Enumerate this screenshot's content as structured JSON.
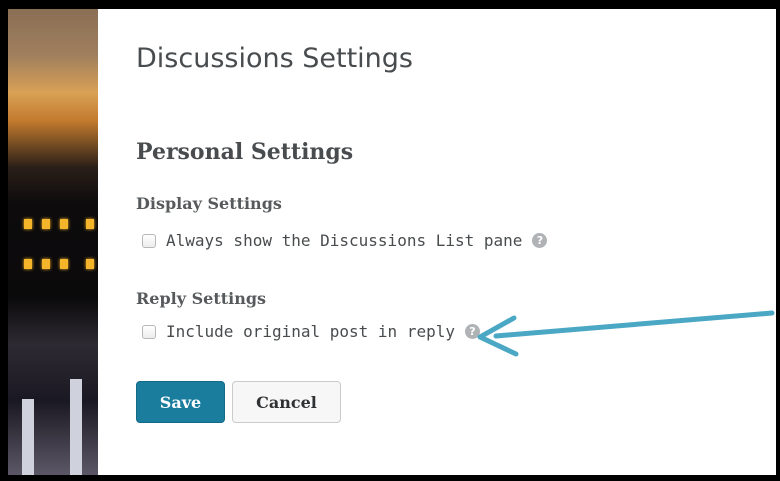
{
  "page": {
    "title": "Discussions Settings"
  },
  "personal_settings": {
    "title": "Personal Settings",
    "display_settings": {
      "title": "Display Settings",
      "option_label": "Always show the Discussions List pane",
      "checked": false,
      "help_icon": "question-circle-icon"
    },
    "reply_settings": {
      "title": "Reply Settings",
      "option_label": "Include original post in reply",
      "checked": false,
      "help_icon": "question-circle-icon"
    }
  },
  "actions": {
    "save_label": "Save",
    "cancel_label": "Cancel"
  },
  "annotation": {
    "icon": "arrow-left-icon",
    "color": "#4aa8c4"
  },
  "colors": {
    "primary_button": "#1a7d9e",
    "text": "#494c4e"
  }
}
